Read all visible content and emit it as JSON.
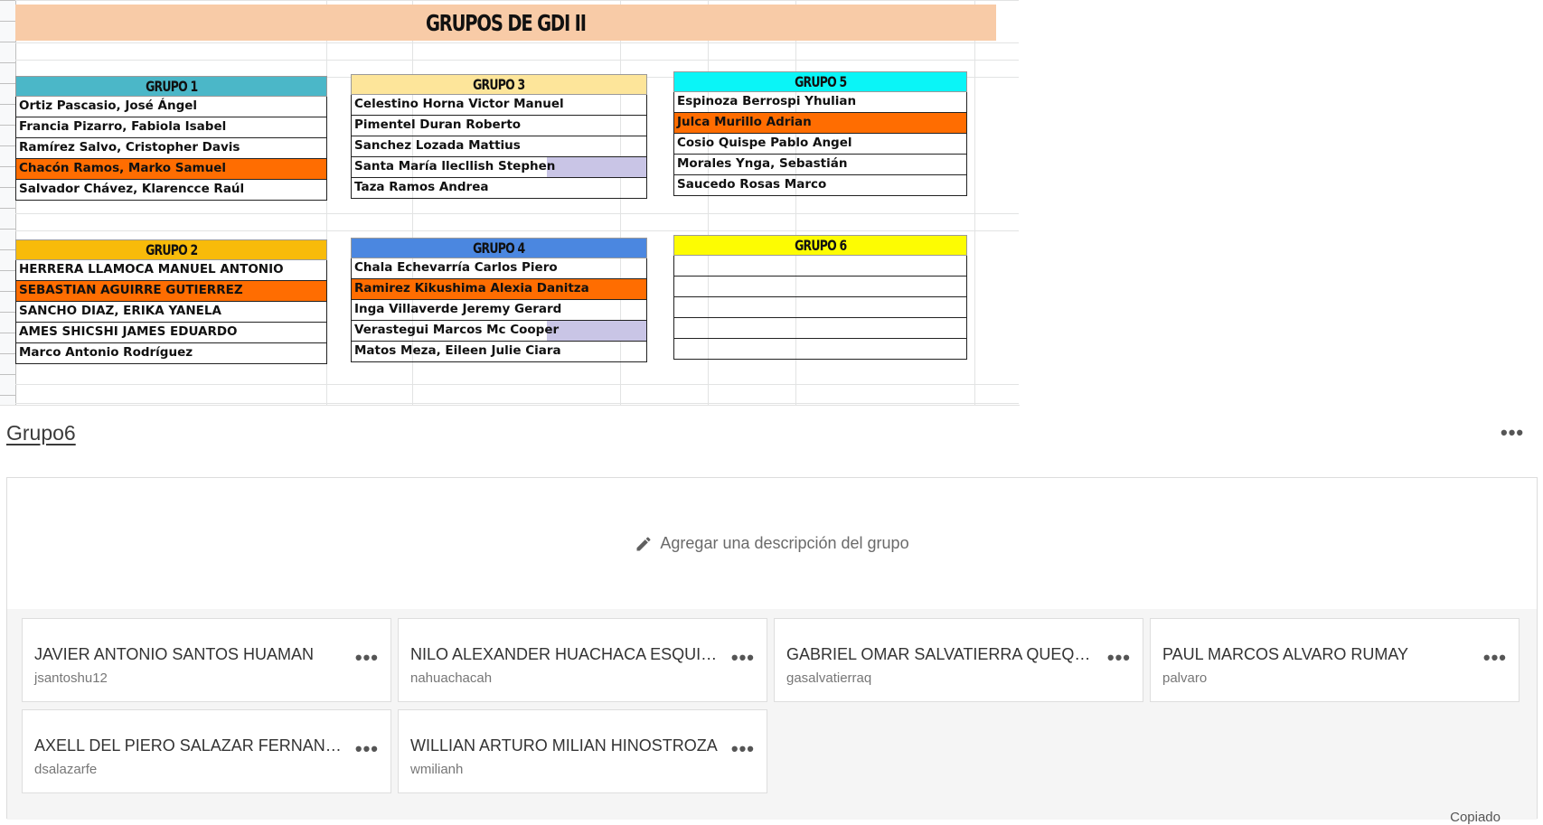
{
  "sheet": {
    "title": "GRUPOS DE GDI II",
    "groups": [
      {
        "header": "GRUPO 1",
        "color": "#4bb7c8",
        "rows": [
          {
            "text": "Ortiz Pascasio, José Ángel",
            "highlight": false
          },
          {
            "text": "Francia Pizarro, Fabiola Isabel",
            "highlight": false
          },
          {
            "text": "Ramírez Salvo, Cristopher Davis",
            "highlight": false
          },
          {
            "text": "Chacón Ramos, Marko Samuel",
            "highlight": true
          },
          {
            "text": "Salvador Chávez, Klarencce Raúl",
            "highlight": false
          }
        ]
      },
      {
        "header": "GRUPO 2",
        "color": "#f8bb0a",
        "rows": [
          {
            "text": "HERRERA LLAMOCA MANUEL ANTONIO",
            "highlight": false
          },
          {
            "text": "SEBASTIAN AGUIRRE GUTIERREZ",
            "highlight": true
          },
          {
            "text": "SANCHO DIAZ, ERIKA YANELA",
            "highlight": false
          },
          {
            "text": "AMES SHICSHI JAMES EDUARDO",
            "highlight": false
          },
          {
            "text": "Marco Antonio Rodríguez",
            "highlight": false
          }
        ]
      },
      {
        "header": "GRUPO 3",
        "color": "#fde59a",
        "rows": [
          {
            "text": "Celestino Horna Victor Manuel",
            "highlight": false
          },
          {
            "text": "Pimentel Duran Roberto",
            "highlight": false
          },
          {
            "text": "Sanchez Lozada Mattius",
            "highlight": false
          },
          {
            "text": "Santa María llecllish Stephen",
            "highlight": false
          },
          {
            "text": "Taza Ramos Andrea",
            "highlight": false
          }
        ]
      },
      {
        "header": "GRUPO 4",
        "color": "#4b87e0",
        "rows": [
          {
            "text": "Chala Echevarría Carlos Piero",
            "highlight": false
          },
          {
            "text": "Ramirez Kikushima Alexia Danitza",
            "highlight": true
          },
          {
            "text": "Inga Villaverde Jeremy Gerard",
            "highlight": false
          },
          {
            "text": "Verastegui Marcos Mc Cooper",
            "highlight": false
          },
          {
            "text": "Matos Meza, Eileen Julie Ciara",
            "highlight": false
          }
        ]
      },
      {
        "header": "GRUPO 5",
        "color": "#0af5f7",
        "rows": [
          {
            "text": "Espinoza Berrospi Yhulian",
            "highlight": false
          },
          {
            "text": "Julca Murillo Adrian",
            "highlight": true
          },
          {
            "text": "Cosio Quispe Pablo Angel",
            "highlight": false
          },
          {
            "text": "Morales Ynga, Sebastián",
            "highlight": false
          },
          {
            "text": "Saucedo Rosas Marco",
            "highlight": false
          }
        ]
      },
      {
        "header": "GRUPO 6",
        "color": "#fdfc02",
        "rows": [
          {
            "text": "",
            "highlight": false
          },
          {
            "text": "",
            "highlight": false
          },
          {
            "text": "",
            "highlight": false
          },
          {
            "text": "",
            "highlight": false
          },
          {
            "text": "",
            "highlight": false
          }
        ]
      }
    ]
  },
  "group_section": {
    "title": "Grupo6",
    "menu_icon": "more-horizontal-icon",
    "description_prompt": "Agregar una descripción del grupo",
    "description_icon": "pencil-icon",
    "members": [
      {
        "name": "JAVIER ANTONIO SANTOS HUAMAN",
        "username": "jsantoshu12"
      },
      {
        "name": "NILO ALEXANDER HUACHACA ESQUIVEL",
        "username": "nahuachacah"
      },
      {
        "name": "GABRIEL OMAR SALVATIERRA QUEQUES...",
        "username": "gasalvatierraq"
      },
      {
        "name": "PAUL MARCOS ALVARO RUMAY",
        "username": "palvaro"
      },
      {
        "name": "AXELL DEL PIERO SALAZAR FERNANDEZ",
        "username": "dsalazarfe"
      },
      {
        "name": "WILLIAN ARTURO MILIAN HINOSTROZA",
        "username": "wmilianh"
      }
    ],
    "footer_text": "Copiado"
  }
}
